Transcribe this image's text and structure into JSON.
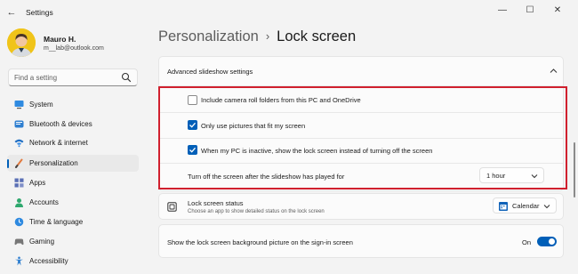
{
  "window": {
    "title": "Settings",
    "back_glyph": "←",
    "minimize_glyph": "—",
    "maximize_glyph": "☐",
    "close_glyph": "✕"
  },
  "profile": {
    "name": "Mauro H.",
    "email": "m__lab@outlook.com"
  },
  "search": {
    "placeholder": "Find a setting"
  },
  "sidebar": {
    "items": [
      {
        "label": "System",
        "icon": "monitor-icon"
      },
      {
        "label": "Bluetooth & devices",
        "icon": "bluetooth-icon"
      },
      {
        "label": "Network & internet",
        "icon": "wifi-icon"
      },
      {
        "label": "Personalization",
        "icon": "brush-icon",
        "active": true
      },
      {
        "label": "Apps",
        "icon": "apps-icon"
      },
      {
        "label": "Accounts",
        "icon": "person-icon"
      },
      {
        "label": "Time & language",
        "icon": "globe-clock-icon"
      },
      {
        "label": "Gaming",
        "icon": "gamepad-icon"
      },
      {
        "label": "Accessibility",
        "icon": "accessibility-icon"
      }
    ]
  },
  "header": {
    "parent": "Personalization",
    "separator": "›",
    "current": "Lock screen"
  },
  "slideshow": {
    "section_title": "Advanced slideshow settings",
    "options": [
      {
        "label": "Include camera roll folders from this PC and OneDrive",
        "checked": false
      },
      {
        "label": "Only use pictures that fit my screen",
        "checked": true
      },
      {
        "label": "When my PC is inactive, show the lock screen instead of turning off the screen",
        "checked": true
      }
    ],
    "turn_off": {
      "label": "Turn off the screen after the slideshow has played for",
      "value": "1 hour"
    }
  },
  "status": {
    "title": "Lock screen status",
    "description": "Choose an app to show detailed status on the lock screen",
    "value": "Calendar"
  },
  "signin": {
    "label": "Show the lock screen background picture on the sign-in screen",
    "toggle_label": "On",
    "toggle_on": true
  },
  "colors": {
    "accent": "#005fb8",
    "highlight": "#d0202e"
  }
}
